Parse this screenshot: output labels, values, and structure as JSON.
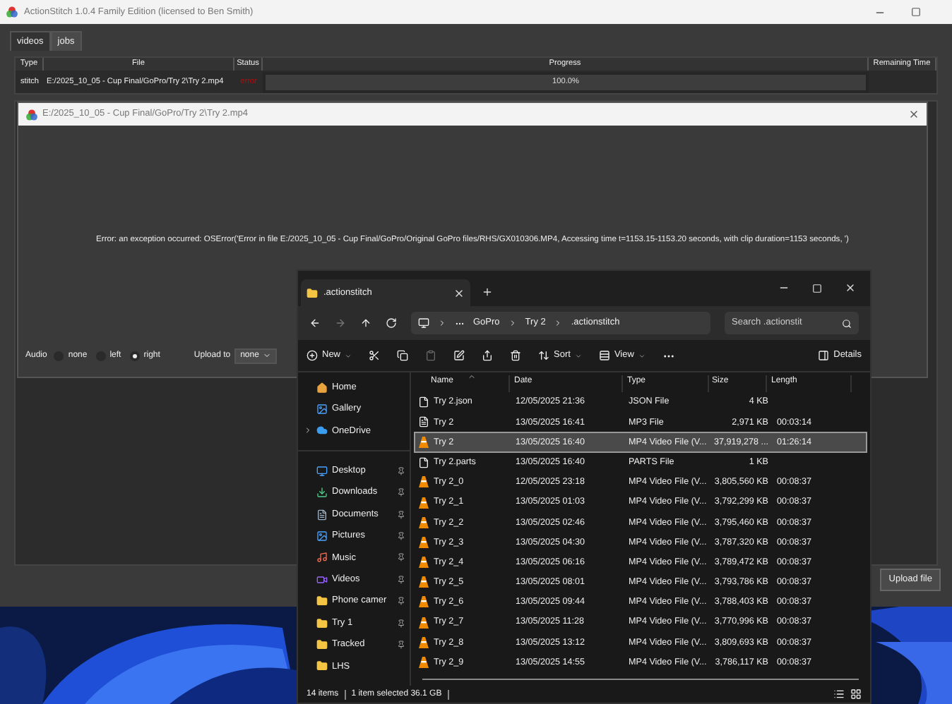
{
  "app_window": {
    "title": "ActionStitch 1.0.4 Family Edition (licensed to Ben Smith)"
  },
  "tabs": [
    {
      "label": "videos",
      "selected": false
    },
    {
      "label": "jobs",
      "selected": true
    }
  ],
  "jobs_table": {
    "columns": [
      "Type",
      "File",
      "Status",
      "Progress",
      "Remaining Time"
    ],
    "rows": [
      {
        "type": "stitch",
        "file": "E:/2025_10_05 - Cup Final/GoPro/Try 2\\Try 2.mp4",
        "status": "error",
        "kind": "error",
        "level": 1,
        "progress": "100.0%"
      }
    ]
  },
  "job_dialog": {
    "title": "E:/2025_10_05 - Cup Final/GoPro/Try 2\\Try 2.mp4",
    "message": "Error: an exception occurred: OSError('Error in file E:/2025_10_05 - Cup Final/GoPro/Original GoPro files/RHS/GX010306.MP4, Accessing time t=1153.15-1153.20 seconds, with clip duration=1153 seconds, ')",
    "audio_label": "Audio",
    "audio_options": [
      {
        "label": "none",
        "selected": false
      },
      {
        "label": "left",
        "selected": false
      },
      {
        "label": "right",
        "selected": true
      }
    ],
    "upload_label": "Upload to",
    "upload_value": "none"
  },
  "upload_button": "Upload file",
  "explorer": {
    "tab": ".actionstitch",
    "breadcrumb": [
      "GoPro",
      "Try 2",
      ".actionstitch"
    ],
    "search": {
      "placeholder": "Search .actionstit"
    },
    "toolbar": {
      "new": "New",
      "sort": "Sort",
      "view": "View",
      "details": "Details"
    },
    "sidebar": {
      "groups": [
        [
          {
            "label": "Home",
            "kind": "home",
            "pinned": false
          },
          {
            "label": "Gallery",
            "kind": "gallery",
            "pinned": false
          },
          {
            "label": "OneDrive",
            "kind": "cloud",
            "pinned": false
          }
        ],
        [
          {
            "label": "Desktop",
            "kind": "desktop",
            "pinned": true
          },
          {
            "label": "Downloads",
            "kind": "downloads",
            "pinned": true
          },
          {
            "label": "Documents",
            "kind": "documents",
            "pinned": true
          },
          {
            "label": "Pictures",
            "kind": "pictures",
            "pinned": true
          },
          {
            "label": "Music",
            "kind": "music",
            "pinned": true
          },
          {
            "label": "Videos",
            "kind": "videos",
            "pinned": true
          },
          {
            "label": "Phone camer",
            "kind": "folder",
            "pinned": true
          },
          {
            "label": "Try 1",
            "kind": "folder",
            "pinned": true
          },
          {
            "label": "Tracked",
            "kind": "folder",
            "pinned": true
          },
          {
            "label": "LHS",
            "kind": "folder",
            "pinned": false
          }
        ]
      ]
    },
    "columns": [
      "Name",
      "Date",
      "Type",
      "Size",
      "Length"
    ],
    "files": [
      {
        "name": "Try 2.json",
        "date": "12/05/2025 21:36",
        "type": "JSON File",
        "size": "4 KB",
        "kind": "doc",
        "selected": false
      },
      {
        "name": "Try 2",
        "date": "13/05/2025 16:41",
        "type": "MP3 File",
        "size": "2,971 KB",
        "length": "00:03:14",
        "kind": "audio",
        "selected": false
      },
      {
        "name": "Try 2",
        "date": "13/05/2025 16:40",
        "type": "MP4 Video File (V...",
        "size": "37,919,278 ...",
        "length": "01:26:14",
        "kind": "video",
        "selected": true
      },
      {
        "name": "Try 2.parts",
        "date": "13/05/2025 16:40",
        "type": "PARTS File",
        "size": "1 KB",
        "kind": "doc",
        "selected": false
      },
      {
        "name": "Try 2_0",
        "date": "12/05/2025 23:18",
        "type": "MP4 Video File (V...",
        "size": "3,805,560 KB",
        "length": "00:08:37",
        "kind": "video",
        "selected": false
      },
      {
        "name": "Try 2_1",
        "date": "13/05/2025 01:03",
        "type": "MP4 Video File (V...",
        "size": "3,792,299 KB",
        "length": "00:08:37",
        "kind": "video",
        "selected": false
      },
      {
        "name": "Try 2_2",
        "date": "13/05/2025 02:46",
        "type": "MP4 Video File (V...",
        "size": "3,795,460 KB",
        "length": "00:08:37",
        "kind": "video",
        "selected": false
      },
      {
        "name": "Try 2_3",
        "date": "13/05/2025 04:30",
        "type": "MP4 Video File (V...",
        "size": "3,787,320 KB",
        "length": "00:08:37",
        "kind": "video",
        "selected": false
      },
      {
        "name": "Try 2_4",
        "date": "13/05/2025 06:16",
        "type": "MP4 Video File (V...",
        "size": "3,789,472 KB",
        "length": "00:08:37",
        "kind": "video",
        "selected": false
      },
      {
        "name": "Try 2_5",
        "date": "13/05/2025 08:01",
        "type": "MP4 Video File (V...",
        "size": "3,793,786 KB",
        "length": "00:08:37",
        "kind": "video",
        "selected": false
      },
      {
        "name": "Try 2_6",
        "date": "13/05/2025 09:44",
        "type": "MP4 Video File (V...",
        "size": "3,788,403 KB",
        "length": "00:08:37",
        "kind": "video",
        "selected": false
      },
      {
        "name": "Try 2_7",
        "date": "13/05/2025 11:28",
        "type": "MP4 Video File (V...",
        "size": "3,770,996 KB",
        "length": "00:08:37",
        "kind": "video",
        "selected": false
      },
      {
        "name": "Try 2_8",
        "date": "13/05/2025 13:12",
        "type": "MP4 Video File (V...",
        "size": "3,809,693 KB",
        "length": "00:08:37",
        "kind": "video",
        "selected": false
      },
      {
        "name": "Try 2_9",
        "date": "13/05/2025 14:55",
        "type": "MP4 Video File (V...",
        "size": "3,786,117 KB",
        "length": "00:08:37",
        "kind": "video",
        "selected": false
      }
    ],
    "status": {
      "count": "14 items",
      "selection": "1 item selected 36.1 GB"
    }
  }
}
